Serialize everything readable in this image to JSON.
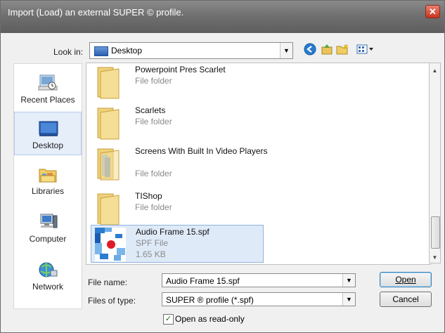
{
  "window": {
    "title": "Import (Load) an external SUPER © profile.",
    "close_glyph": "✕"
  },
  "toolbar": {
    "look_in_label": "Look in:",
    "look_in_value": "Desktop",
    "icons": [
      "back-icon",
      "up-folder-icon",
      "new-folder-icon",
      "view-menu-icon"
    ]
  },
  "places": [
    {
      "label": "Recent Places",
      "icon": "recent-places-icon"
    },
    {
      "label": "Desktop",
      "icon": "desktop-icon",
      "selected": true
    },
    {
      "label": "Libraries",
      "icon": "libraries-icon"
    },
    {
      "label": "Computer",
      "icon": "computer-icon"
    },
    {
      "label": "Network",
      "icon": "network-icon"
    }
  ],
  "files": [
    {
      "name": "Powerpoint Pres Scarlet",
      "type": "File folder"
    },
    {
      "name": "Scarlets",
      "type": "File folder"
    },
    {
      "name": "Screens With Built In Video Players",
      "type": "File folder"
    },
    {
      "name": "TIShop",
      "type": "File folder"
    },
    {
      "name": "Audio Frame 15.spf",
      "type": "SPF File",
      "size": "1.65 KB",
      "selected": true
    }
  ],
  "form": {
    "file_name_label": "File name:",
    "file_name_value": "Audio Frame 15.spf",
    "file_type_label": "Files of type:",
    "file_type_value": "SUPER ® profile (*.spf)",
    "readonly_label": "Open as read-only",
    "readonly_checked": true
  },
  "buttons": {
    "open": "Open",
    "cancel": "Cancel"
  }
}
